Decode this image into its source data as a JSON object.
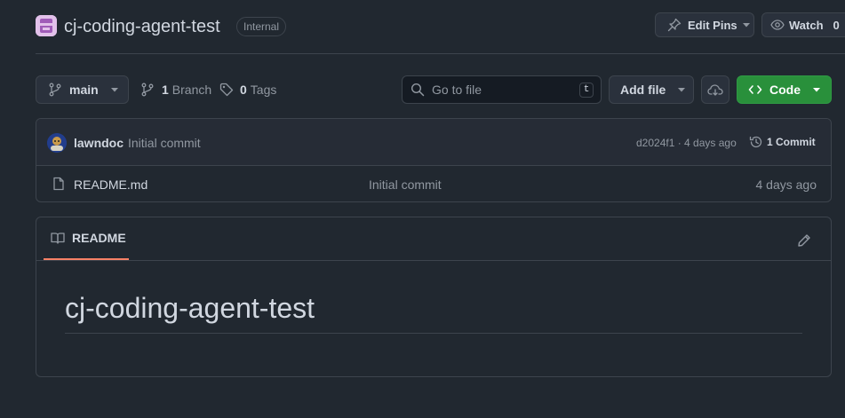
{
  "repo": {
    "name": "cj-coding-agent-test",
    "visibility": "Internal"
  },
  "actions": {
    "edit_pins": "Edit Pins",
    "watch": "Watch",
    "watch_count": "0"
  },
  "toolbar": {
    "branch": "main",
    "branch_count": "1",
    "branch_label": "Branch",
    "tag_count": "0",
    "tag_label": "Tags",
    "go_to_file_placeholder": "Go to file",
    "go_to_file_shortcut": "t",
    "add_file": "Add file",
    "code": "Code"
  },
  "latest_commit": {
    "author": "lawndoc",
    "message": "Initial commit",
    "meta": "d2024f1 · 4 days ago",
    "count_label": "1 Commit"
  },
  "files": [
    {
      "name": "README.md",
      "message": "Initial commit",
      "age": "4 days ago"
    }
  ],
  "readme": {
    "tab_label": "README",
    "heading": "cj-coding-agent-test"
  },
  "colors": {
    "background": "#212830",
    "border": "#3d444d",
    "code_button": "#29903b",
    "tab_underline": "#f78166"
  }
}
